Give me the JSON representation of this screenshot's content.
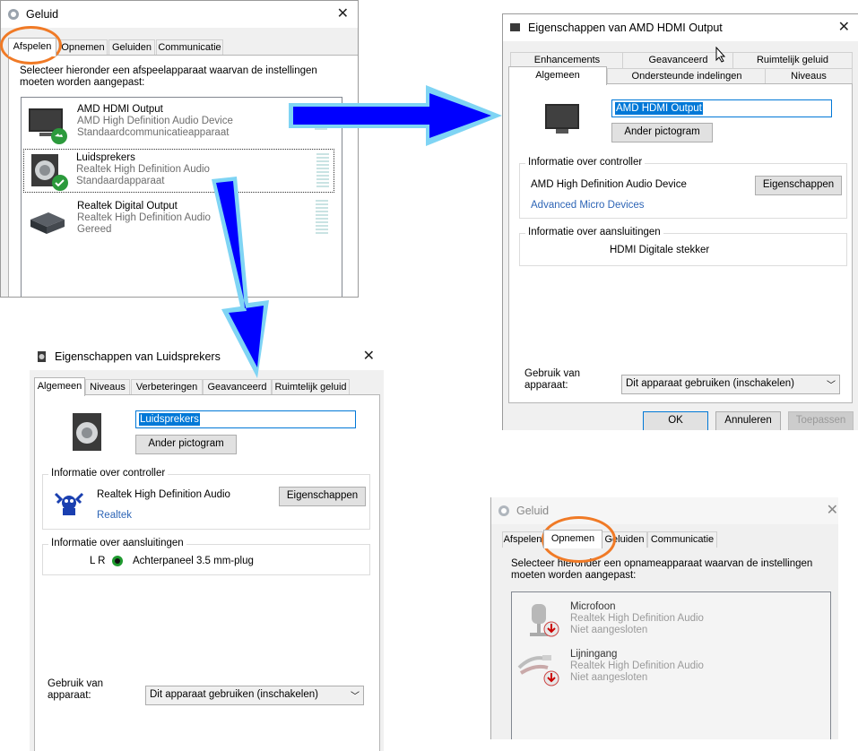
{
  "playback_window": {
    "title": "Geluid",
    "tabs": [
      "Afspelen",
      "Opnemen",
      "Geluiden",
      "Communicatie"
    ],
    "instruction": "Selecteer hieronder een afspeelapparaat waarvan de instellingen moeten worden aangepast:",
    "devices": [
      {
        "name": "AMD HDMI Output",
        "driver": "AMD High Definition Audio Device",
        "status": "Standaardcommunicatieapparaat"
      },
      {
        "name": "Luidsprekers",
        "driver": "Realtek High Definition Audio",
        "status": "Standaardapparaat"
      },
      {
        "name": "Realtek Digital Output",
        "driver": "Realtek High Definition Audio",
        "status": "Gereed"
      }
    ]
  },
  "hdmi_props": {
    "title": "Eigenschappen van AMD HDMI Output",
    "tabs_top": [
      "Enhancements",
      "Geavanceerd",
      "Ruimtelijk geluid"
    ],
    "tabs_bottom": [
      "Algemeen",
      "Ondersteunde indelingen",
      "Niveaus"
    ],
    "device_name": "AMD HDMI Output",
    "change_icon": "Ander pictogram",
    "controller_group": "Informatie over controller",
    "controller_name": "AMD High Definition Audio Device",
    "properties_button": "Eigenschappen",
    "vendor": "Advanced Micro Devices",
    "jack_group": "Informatie over aansluitingen",
    "jack": "HDMI Digitale stekker",
    "usage_label_1": "Gebruik van",
    "usage_label_2": "apparaat:",
    "usage_value": "Dit apparaat gebruiken (inschakelen)",
    "ok": "OK",
    "cancel": "Annuleren",
    "apply": "Toepassen"
  },
  "speakers_props": {
    "title": "Eigenschappen van Luidsprekers",
    "tabs": [
      "Algemeen",
      "Niveaus",
      "Verbeteringen",
      "Geavanceerd",
      "Ruimtelijk geluid"
    ],
    "device_name": "Luidsprekers",
    "change_icon": "Ander pictogram",
    "controller_group": "Informatie over controller",
    "controller_name": "Realtek High Definition Audio",
    "properties_button": "Eigenschappen",
    "vendor": "Realtek",
    "jack_group": "Informatie over aansluitingen",
    "jack_channels": "L R",
    "jack": "Achterpaneel 3.5 mm-plug",
    "usage_label_1": "Gebruik van",
    "usage_label_2": "apparaat:",
    "usage_value": "Dit apparaat gebruiken (inschakelen)"
  },
  "recording_window": {
    "title": "Geluid",
    "tabs": [
      "Afspelen",
      "Opnemen",
      "Geluiden",
      "Communicatie"
    ],
    "instruction_1": "Selecteer hieronder een opnameapparaat waarvan de instellingen",
    "instruction_2": "moeten worden aangepast:",
    "devices": [
      {
        "name": "Microfoon",
        "driver": "Realtek High Definition Audio",
        "status": "Niet aangesloten"
      },
      {
        "name": "Lijningang",
        "driver": "Realtek High Definition Audio",
        "status": "Niet aangesloten"
      }
    ]
  },
  "colors": {
    "highlight_ring": "#f07a26",
    "arrow_fill": "#0000ff",
    "arrow_glow": "#7fd4f4",
    "selection": "#0078d7",
    "link": "#2e65b6"
  }
}
